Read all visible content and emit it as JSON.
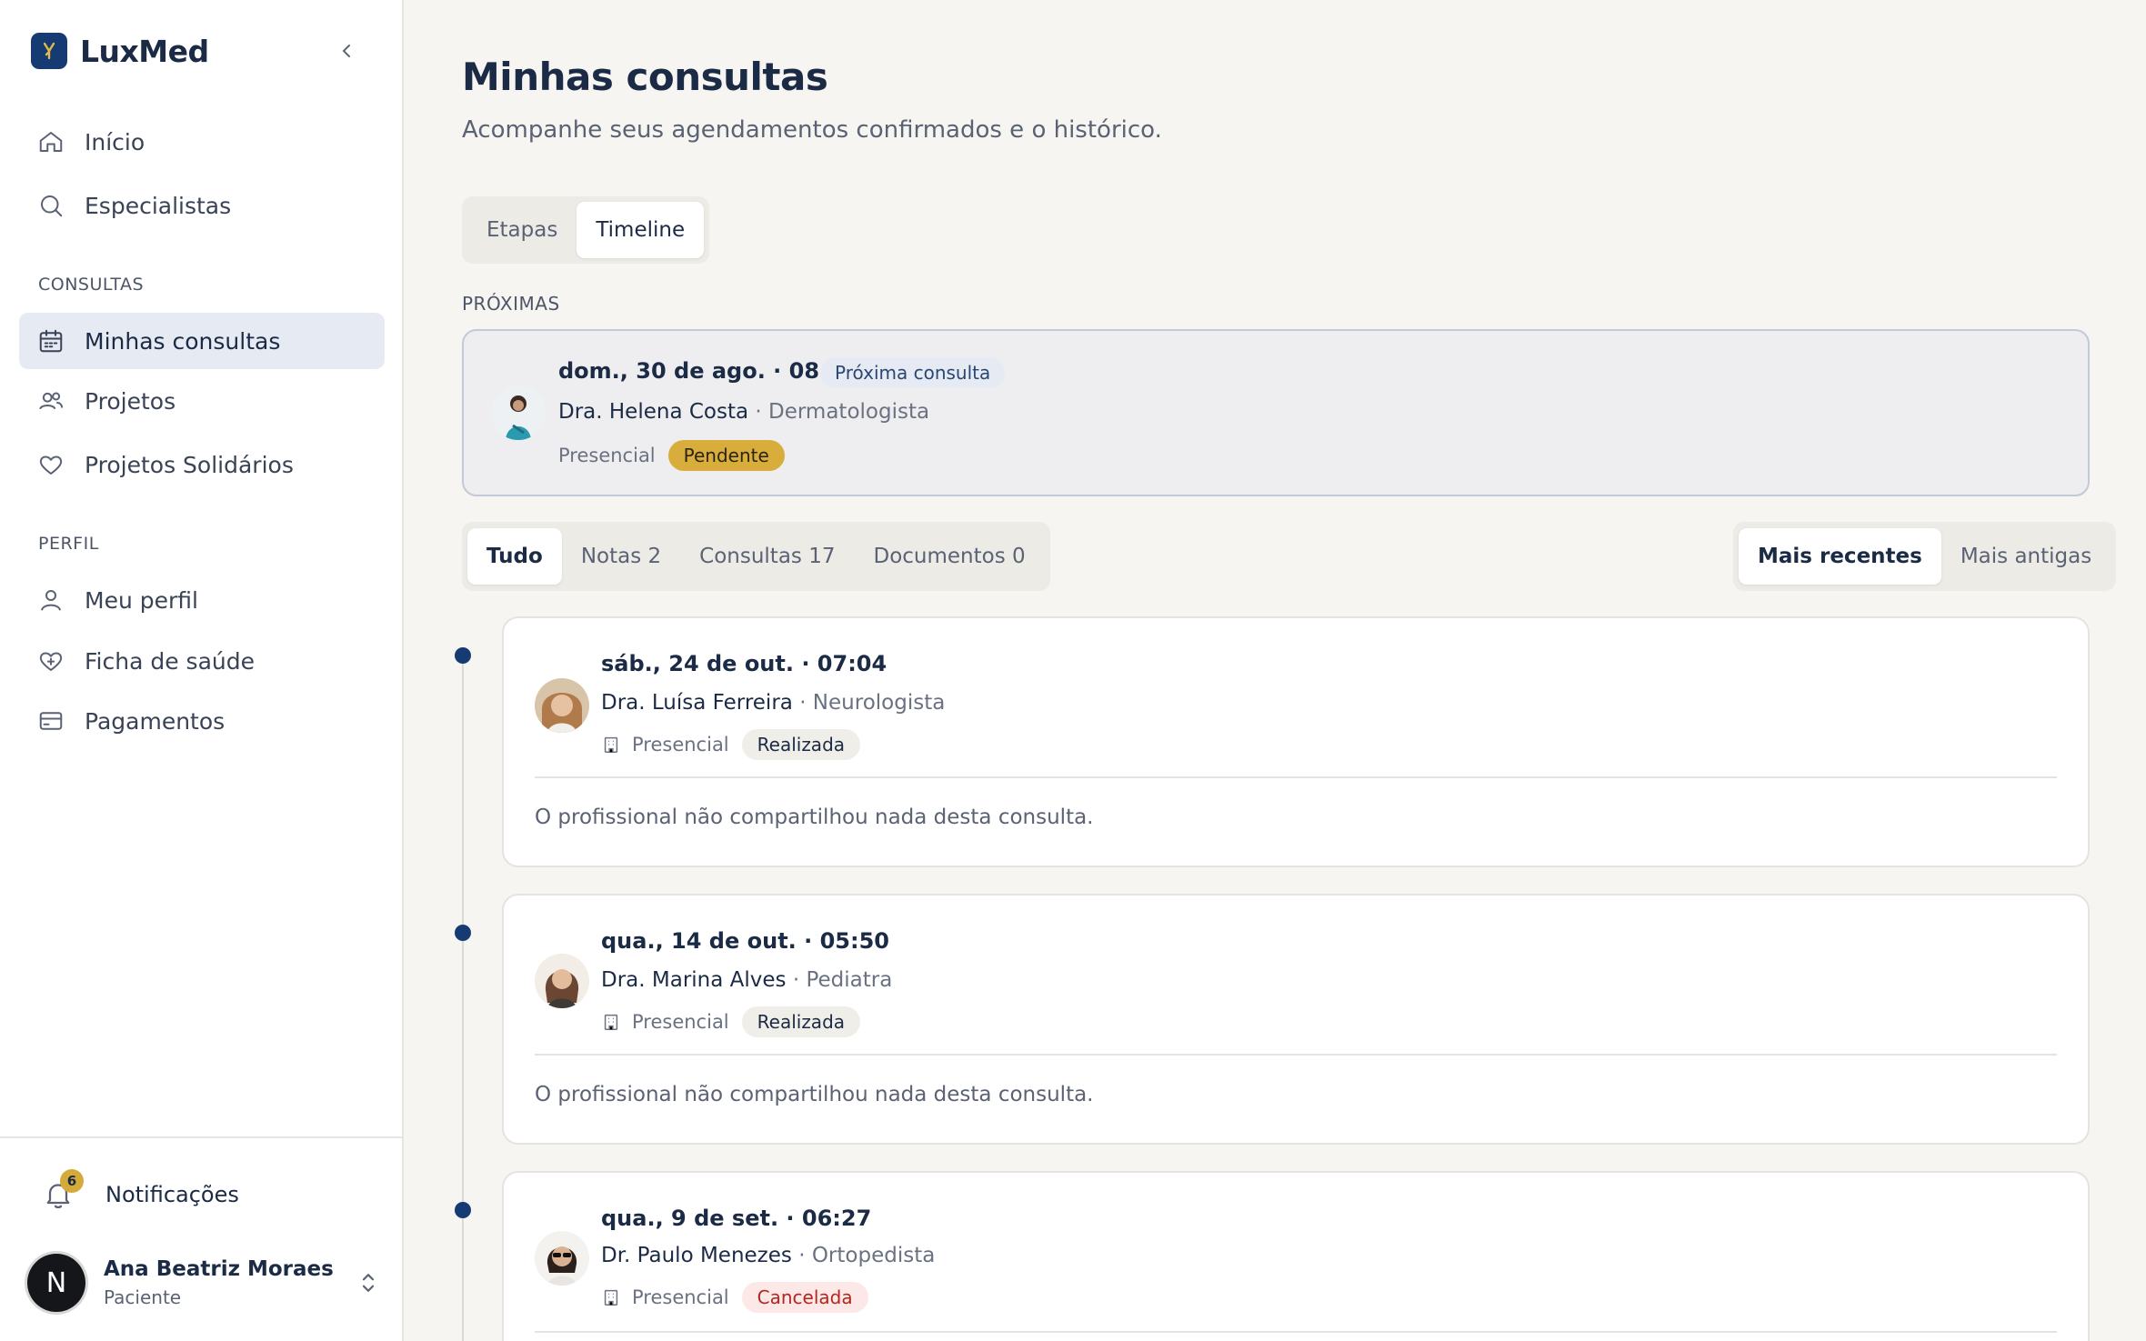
{
  "brand": {
    "name": "LuxMed"
  },
  "sidebar": {
    "items_top": [
      {
        "label": "Início",
        "icon": "home-icon"
      },
      {
        "label": "Especialistas",
        "icon": "search-icon"
      }
    ],
    "section_consultas": "CONSULTAS",
    "items_consultas": [
      {
        "label": "Minhas consultas",
        "icon": "calendar-icon",
        "active": true
      },
      {
        "label": "Projetos",
        "icon": "users-icon"
      },
      {
        "label": "Projetos Solidários",
        "icon": "heart-icon"
      }
    ],
    "section_perfil": "PERFIL",
    "items_perfil": [
      {
        "label": "Meu perfil",
        "icon": "user-icon"
      },
      {
        "label": "Ficha de saúde",
        "icon": "heart-plus-icon"
      },
      {
        "label": "Pagamentos",
        "icon": "credit-card-icon"
      }
    ],
    "notifications": {
      "label": "Notificações",
      "count": "6"
    },
    "user": {
      "initial": "N",
      "name": "Ana Beatriz Moraes",
      "role": "Paciente"
    }
  },
  "main": {
    "title": "Minhas consultas",
    "subtitle": "Acompanhe seus agendamentos confirmados e o histórico.",
    "view_tabs": [
      "Etapas",
      "Timeline"
    ],
    "view_active": "Timeline",
    "upcoming_label": "PRÓXIMAS",
    "next": {
      "date": "dom., 30 de ago. · 08:00",
      "tag": "Próxima consulta",
      "doctor": "Dra. Helena Costa",
      "specialty": "· Dermatologista",
      "mode": "Presencial",
      "status": "Pendente"
    },
    "filters": [
      "Tudo",
      "Notas 2",
      "Consultas 17",
      "Documentos 0"
    ],
    "filter_active": "Tudo",
    "sort": [
      "Mais recentes",
      "Mais antigas"
    ],
    "sort_active": "Mais recentes",
    "history": [
      {
        "date": "sáb., 24 de out. · 07:04",
        "doctor": "Dra. Luísa Ferreira",
        "specialty": "· Neurologista",
        "mode": "Presencial",
        "status": "Realizada",
        "note": "O profissional não compartilhou nada desta consulta."
      },
      {
        "date": "qua., 14 de out. · 05:50",
        "doctor": "Dra. Marina Alves",
        "specialty": "· Pediatra",
        "mode": "Presencial",
        "status": "Realizada",
        "note": "O profissional não compartilhou nada desta consulta."
      },
      {
        "date": "qua., 9 de set. · 06:27",
        "doctor": "Dr. Paulo Menezes",
        "specialty": "· Ortopedista",
        "mode": "Presencial",
        "status": "Cancelada",
        "note": ""
      }
    ]
  }
}
